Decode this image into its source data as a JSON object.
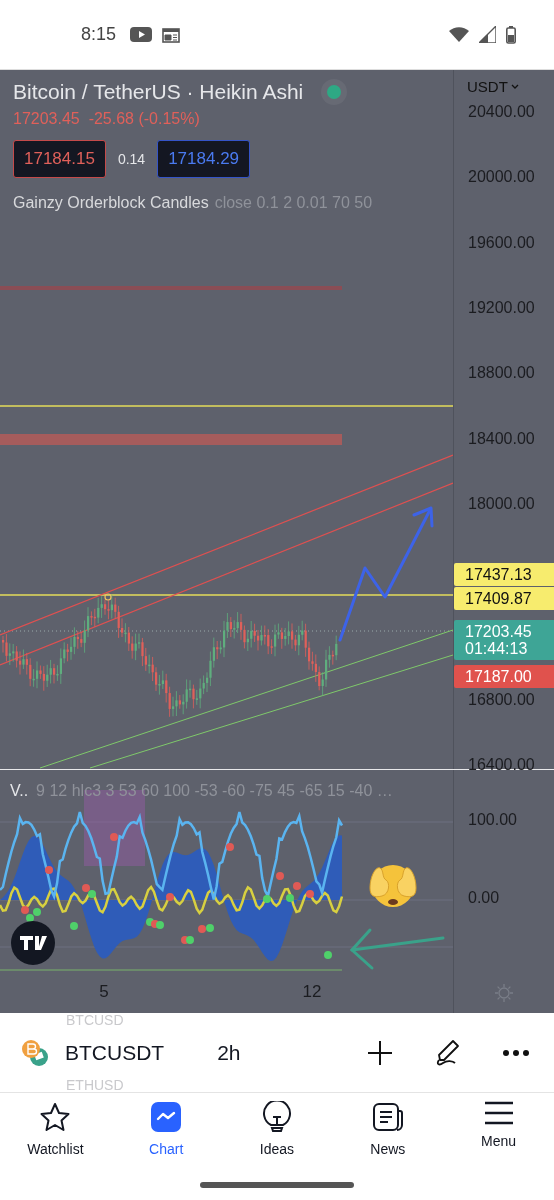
{
  "status_bar": {
    "time": "8:15"
  },
  "chart": {
    "title": "Bitcoin / TetherUS · Heikin Ashi",
    "market_open": true,
    "price": "17203.45",
    "change": "-25.68 (-0.15%)",
    "sell": "17184.15",
    "spread": "0.14",
    "buy": "17184.29",
    "indicator": {
      "name": "Gainzy Orderblock Candles",
      "params": "close 0.1 2 0.01 70 50"
    },
    "currency": "USDT",
    "price_labels": [
      "20400.00",
      "20000.00",
      "19600.00",
      "19200.00",
      "18800.00",
      "18400.00",
      "18000.00",
      "16800.00",
      "16400.00"
    ],
    "price_badges": [
      {
        "kind": "alert",
        "text": "17437.13",
        "color": "#f7ec6e"
      },
      {
        "kind": "alert",
        "text": "17409.87",
        "color": "#f7ec6e"
      },
      {
        "kind": "last",
        "text": "17203.45",
        "countdown": "01:44:13",
        "color": "#3ea596"
      },
      {
        "kind": "low",
        "text": "17187.00",
        "color": "#e0524d"
      }
    ]
  },
  "oscillator": {
    "name": "V..",
    "params": "9 12 hlc3 3 53 60 100 -53 -60 -75 45 -65 15 -40 …",
    "axis_labels": [
      "100.00",
      "0.00"
    ]
  },
  "time_axis": [
    "5",
    "12"
  ],
  "symbol_bar": {
    "previous": "BTCUSD",
    "symbol": "BTCUSDT",
    "interval": "2h",
    "next": "ETHUSD"
  },
  "nav": [
    {
      "label": "Watchlist",
      "selected": false
    },
    {
      "label": "Chart",
      "selected": true
    },
    {
      "label": "Ideas",
      "selected": false
    },
    {
      "label": "News",
      "selected": false
    },
    {
      "label": "Menu",
      "selected": false
    }
  ]
}
